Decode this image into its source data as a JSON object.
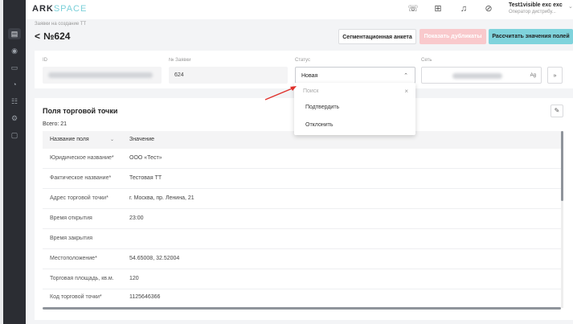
{
  "brand": {
    "logo_main": "ARK",
    "logo_accent": "SPACE",
    "accent_color": "#7bd0d9"
  },
  "sidebar": {
    "icons": [
      "dashboard-icon",
      "database-icon",
      "orders-icon",
      "clock-icon",
      "users-icon",
      "settings-icon",
      "documents-icon"
    ]
  },
  "header": {
    "icons": [
      "support-icon",
      "apps-grid-icon",
      "bell-icon",
      "compass-icon"
    ],
    "user_name": "Test1visible exc exc",
    "user_role": "Оператор дистрибу..."
  },
  "page": {
    "breadcrumb": "Заявки на создание ТТ",
    "title": "№624"
  },
  "toolbar": {
    "segment_label": "Сегментационная анкета",
    "duplicate_label": "Показать дубликаты",
    "calculate_label": "Рассчитать значения полей",
    "calculate_color": "#7fd3dc"
  },
  "filters": {
    "id_label": "ID",
    "order_label": "№ Заявки",
    "order_value": "624",
    "status_label": "Статус",
    "status_value": "Новая",
    "network_label": "Сеть"
  },
  "status_dropdown": {
    "search_placeholder": "Поиск",
    "options": [
      "Подтвердить",
      "Отклонить"
    ]
  },
  "section": {
    "title": "Поля торговой точки",
    "count": "Всего: 21",
    "col_name": "Название поля",
    "col_value": "Значение",
    "rows": [
      {
        "name": "Юридическое название*",
        "value": "ООО «Тест»"
      },
      {
        "name": "Фактическое название*",
        "value": "Тестовая ТТ"
      },
      {
        "name": "Адрес торговой точки*",
        "value": "г. Москва, пр. Ленина, 21"
      },
      {
        "name": "Время открытия",
        "value": "23:00"
      },
      {
        "name": "Время закрытия",
        "value": ""
      },
      {
        "name": "Местоположение*",
        "value": "54.65008, 32.52004"
      },
      {
        "name": "Торговая площадь, кв.м.",
        "value": "120"
      },
      {
        "name": "Код торговой точки*",
        "value": "1125646366"
      }
    ]
  }
}
